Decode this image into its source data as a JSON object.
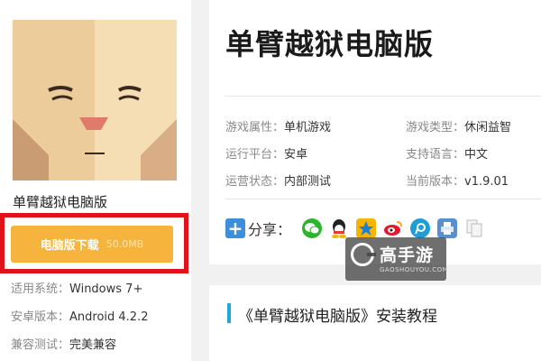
{
  "left": {
    "app_name": "单臂越狱电脑版",
    "download_label": "电脑版下载",
    "download_size": "50.0MB",
    "meta": [
      {
        "key": "适用系统：",
        "value": "Windows 7+"
      },
      {
        "key": "安卓版本：",
        "value": "Android 4.2.2"
      },
      {
        "key": "兼容测试：",
        "value": "完美兼容"
      }
    ]
  },
  "info": {
    "title": "单臂越狱电脑版",
    "attrs": [
      {
        "key": "游戏属性：",
        "value": "单机游戏"
      },
      {
        "key": "游戏类型：",
        "value": "休闲益智"
      },
      {
        "key": "运行平台：",
        "value": "安卓"
      },
      {
        "key": "支持语言：",
        "value": "中文"
      },
      {
        "key": "运营状态：",
        "value": "内部测试"
      },
      {
        "key": "当前版本：",
        "value": "v1.9.01"
      }
    ],
    "share_label": "分享：",
    "share_icons": [
      {
        "name": "wechat-icon",
        "color": "#2bb52b"
      },
      {
        "name": "qq-icon",
        "color": "#ffffff"
      },
      {
        "name": "qzone-icon",
        "color": "#f4b400"
      },
      {
        "name": "weibo-icon",
        "color": "#e6162d"
      },
      {
        "name": "tencent-weibo-icon",
        "color": "#1d9fd6"
      },
      {
        "name": "print-icon",
        "color": "#5a8fcf"
      },
      {
        "name": "copy-icon",
        "color": "#cccccc"
      }
    ]
  },
  "watermark": {
    "text": "高手游",
    "sub": "GAOSHOUYOU.COM"
  },
  "tutorial": {
    "title": "《单臂越狱电脑版》安装教程"
  },
  "colors": {
    "download": "#f6b43d",
    "highlight": "#e2121a",
    "accent_bar": "#21a7d8"
  }
}
